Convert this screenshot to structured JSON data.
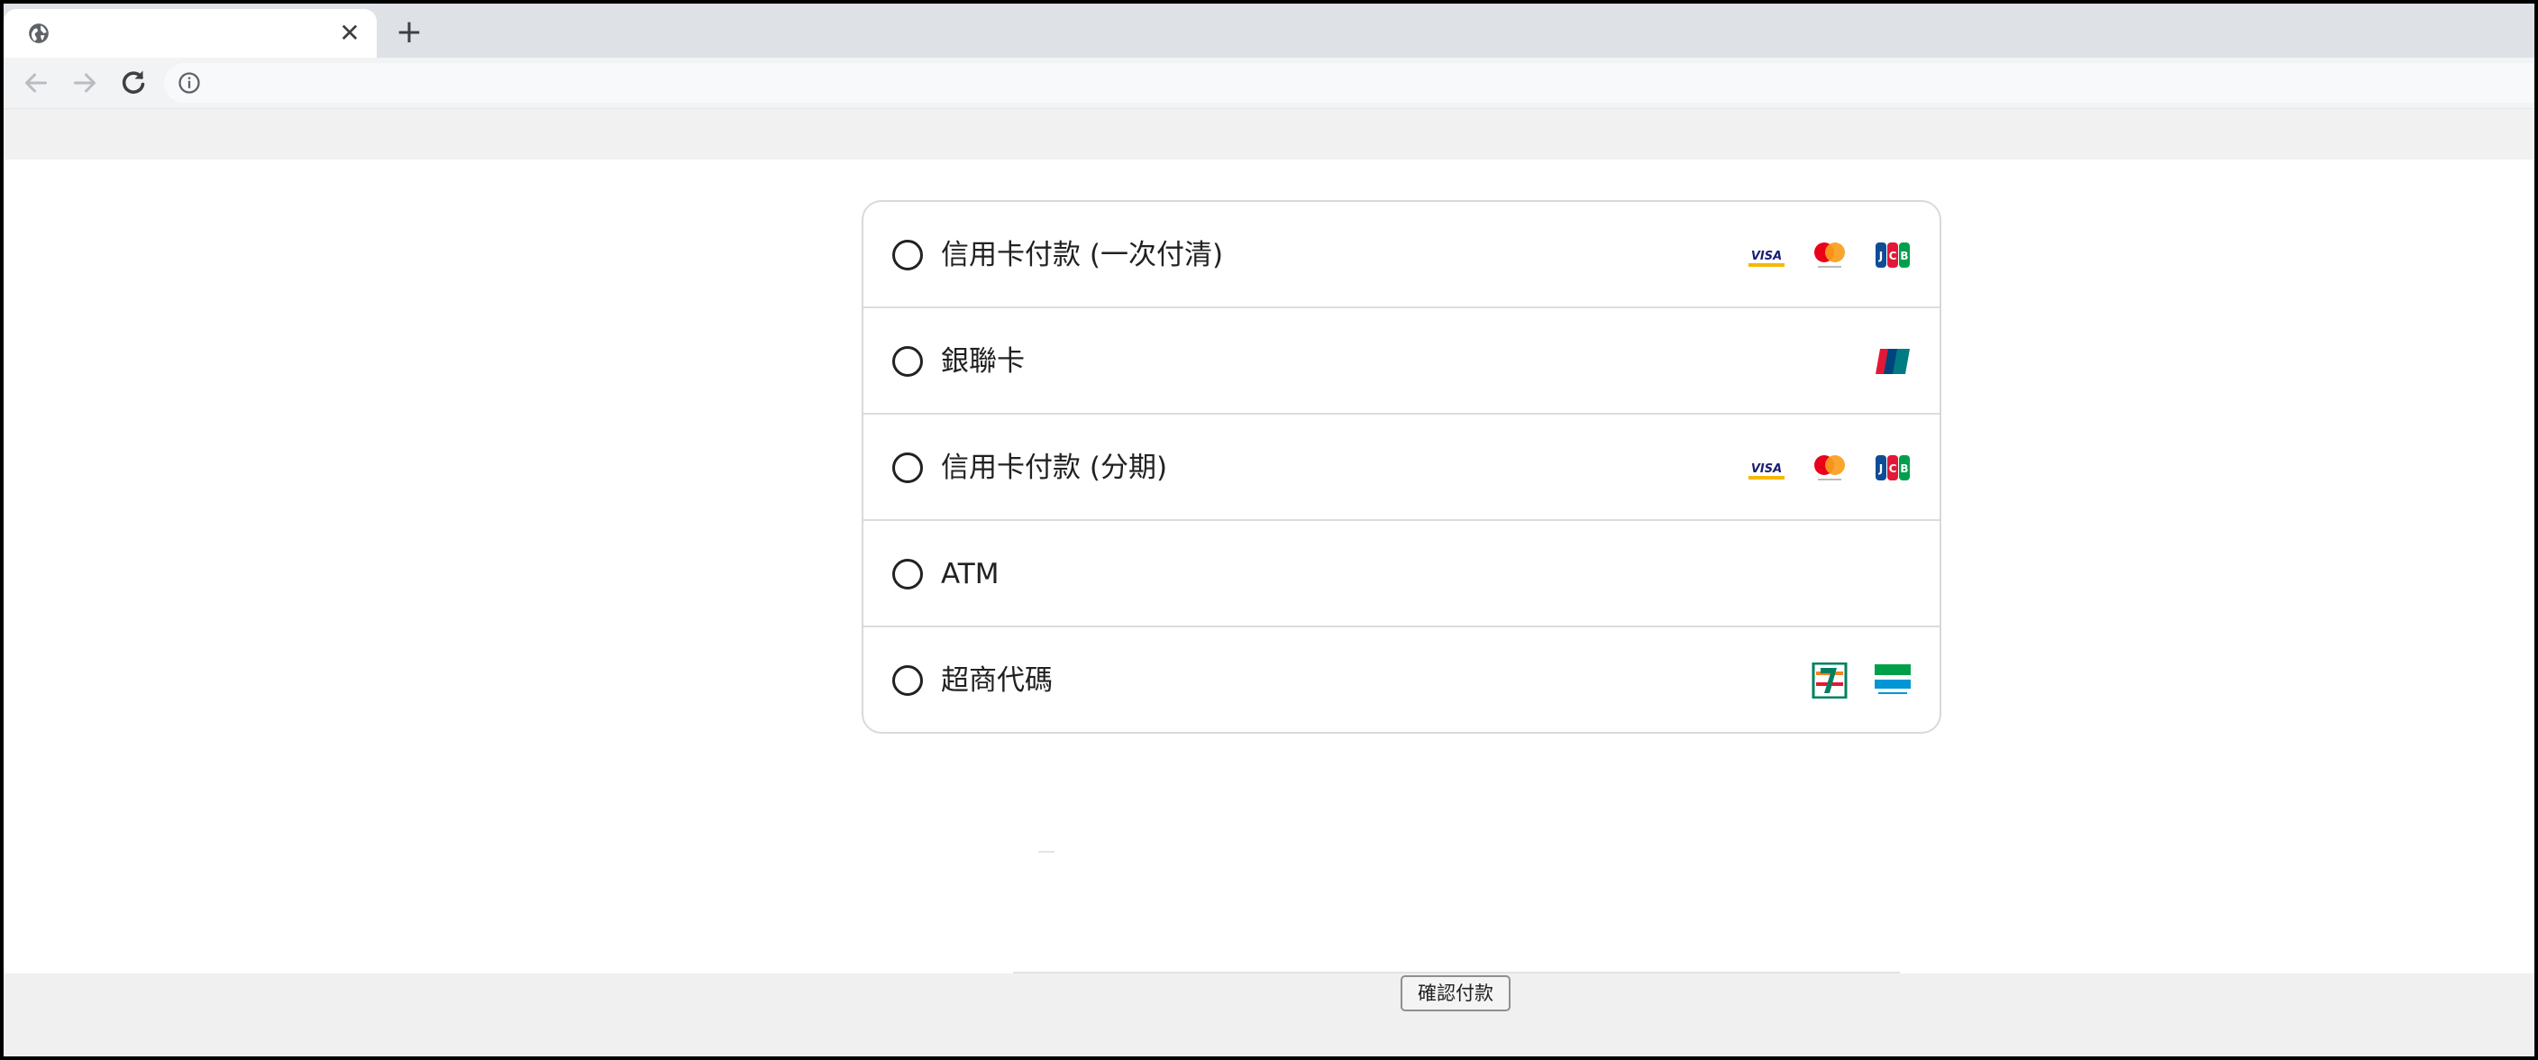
{
  "browser": {
    "tab": {
      "favicon": "globe-icon",
      "close_icon": "close-icon",
      "close_glyph": "✕"
    },
    "new_tab": {
      "icon": "plus-icon",
      "glyph": "+"
    },
    "toolbar": {
      "back_icon": "arrow-left-icon",
      "forward_icon": "arrow-right-icon",
      "reload_icon": "reload-icon",
      "site_info_icon": "info-icon"
    }
  },
  "payment_methods": [
    {
      "label": "信用卡付款 (一次付清)",
      "logos": [
        "visa-logo",
        "mastercard-logo",
        "jcb-logo"
      ]
    },
    {
      "label": "銀聯卡",
      "logos": [
        "unionpay-logo"
      ]
    },
    {
      "label": "信用卡付款 (分期)",
      "logos": [
        "visa-logo",
        "mastercard-logo",
        "jcb-logo"
      ]
    },
    {
      "label": "ATM",
      "logos": []
    },
    {
      "label": "超商代碼",
      "logos": [
        "seven-eleven-logo",
        "familymart-logo"
      ]
    }
  ],
  "footer": {
    "confirm_label": "確認付款"
  },
  "colors": {
    "tabstrip": "#dee1e6",
    "toolbar": "#f1f3f4",
    "border": "#d9d9d9",
    "visa_blue": "#1a1f71",
    "mastercard_red": "#eb001b",
    "mastercard_orange": "#f79e1b",
    "jcb_blue": "#0e4c96",
    "jcb_red": "#e21836",
    "jcb_green": "#009f4d",
    "seven_green": "#008061",
    "seven_orange": "#f58220",
    "familymart_green": "#00a04a",
    "familymart_blue": "#0096d6"
  }
}
